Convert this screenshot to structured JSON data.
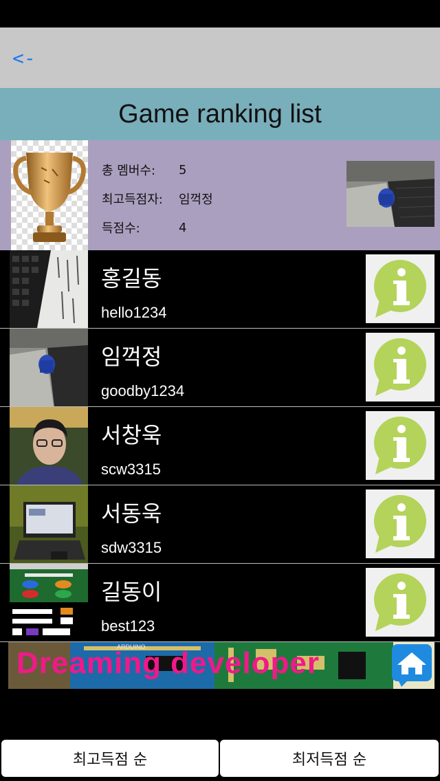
{
  "nav": {
    "back_label": "<-"
  },
  "title": "Game ranking list",
  "summary": {
    "members_label": "총 멤버수:",
    "members_value": "5",
    "top_label": "최고득점자:",
    "top_value": "임꺽정",
    "score_label": "득점수:",
    "score_value": "4"
  },
  "players": [
    {
      "name": "홍길동",
      "id": "hello1234"
    },
    {
      "name": "임꺽정",
      "id": "goodby1234"
    },
    {
      "name": "서창욱",
      "id": "scw3315"
    },
    {
      "name": "서동욱",
      "id": "sdw3315"
    },
    {
      "name": "길동이",
      "id": "best123"
    }
  ],
  "banner": {
    "text": "Dreaming developer",
    "board_label": "ARDUINO"
  },
  "sort": {
    "high_label": "최고득점 순",
    "low_label": "최저득점 순"
  },
  "colors": {
    "nav_bg": "#c8c8c8",
    "title_bg": "#79aebb",
    "summary_bg": "#ab9fbf",
    "info_icon": "#b4d35a",
    "banner_text": "#f0198a"
  }
}
